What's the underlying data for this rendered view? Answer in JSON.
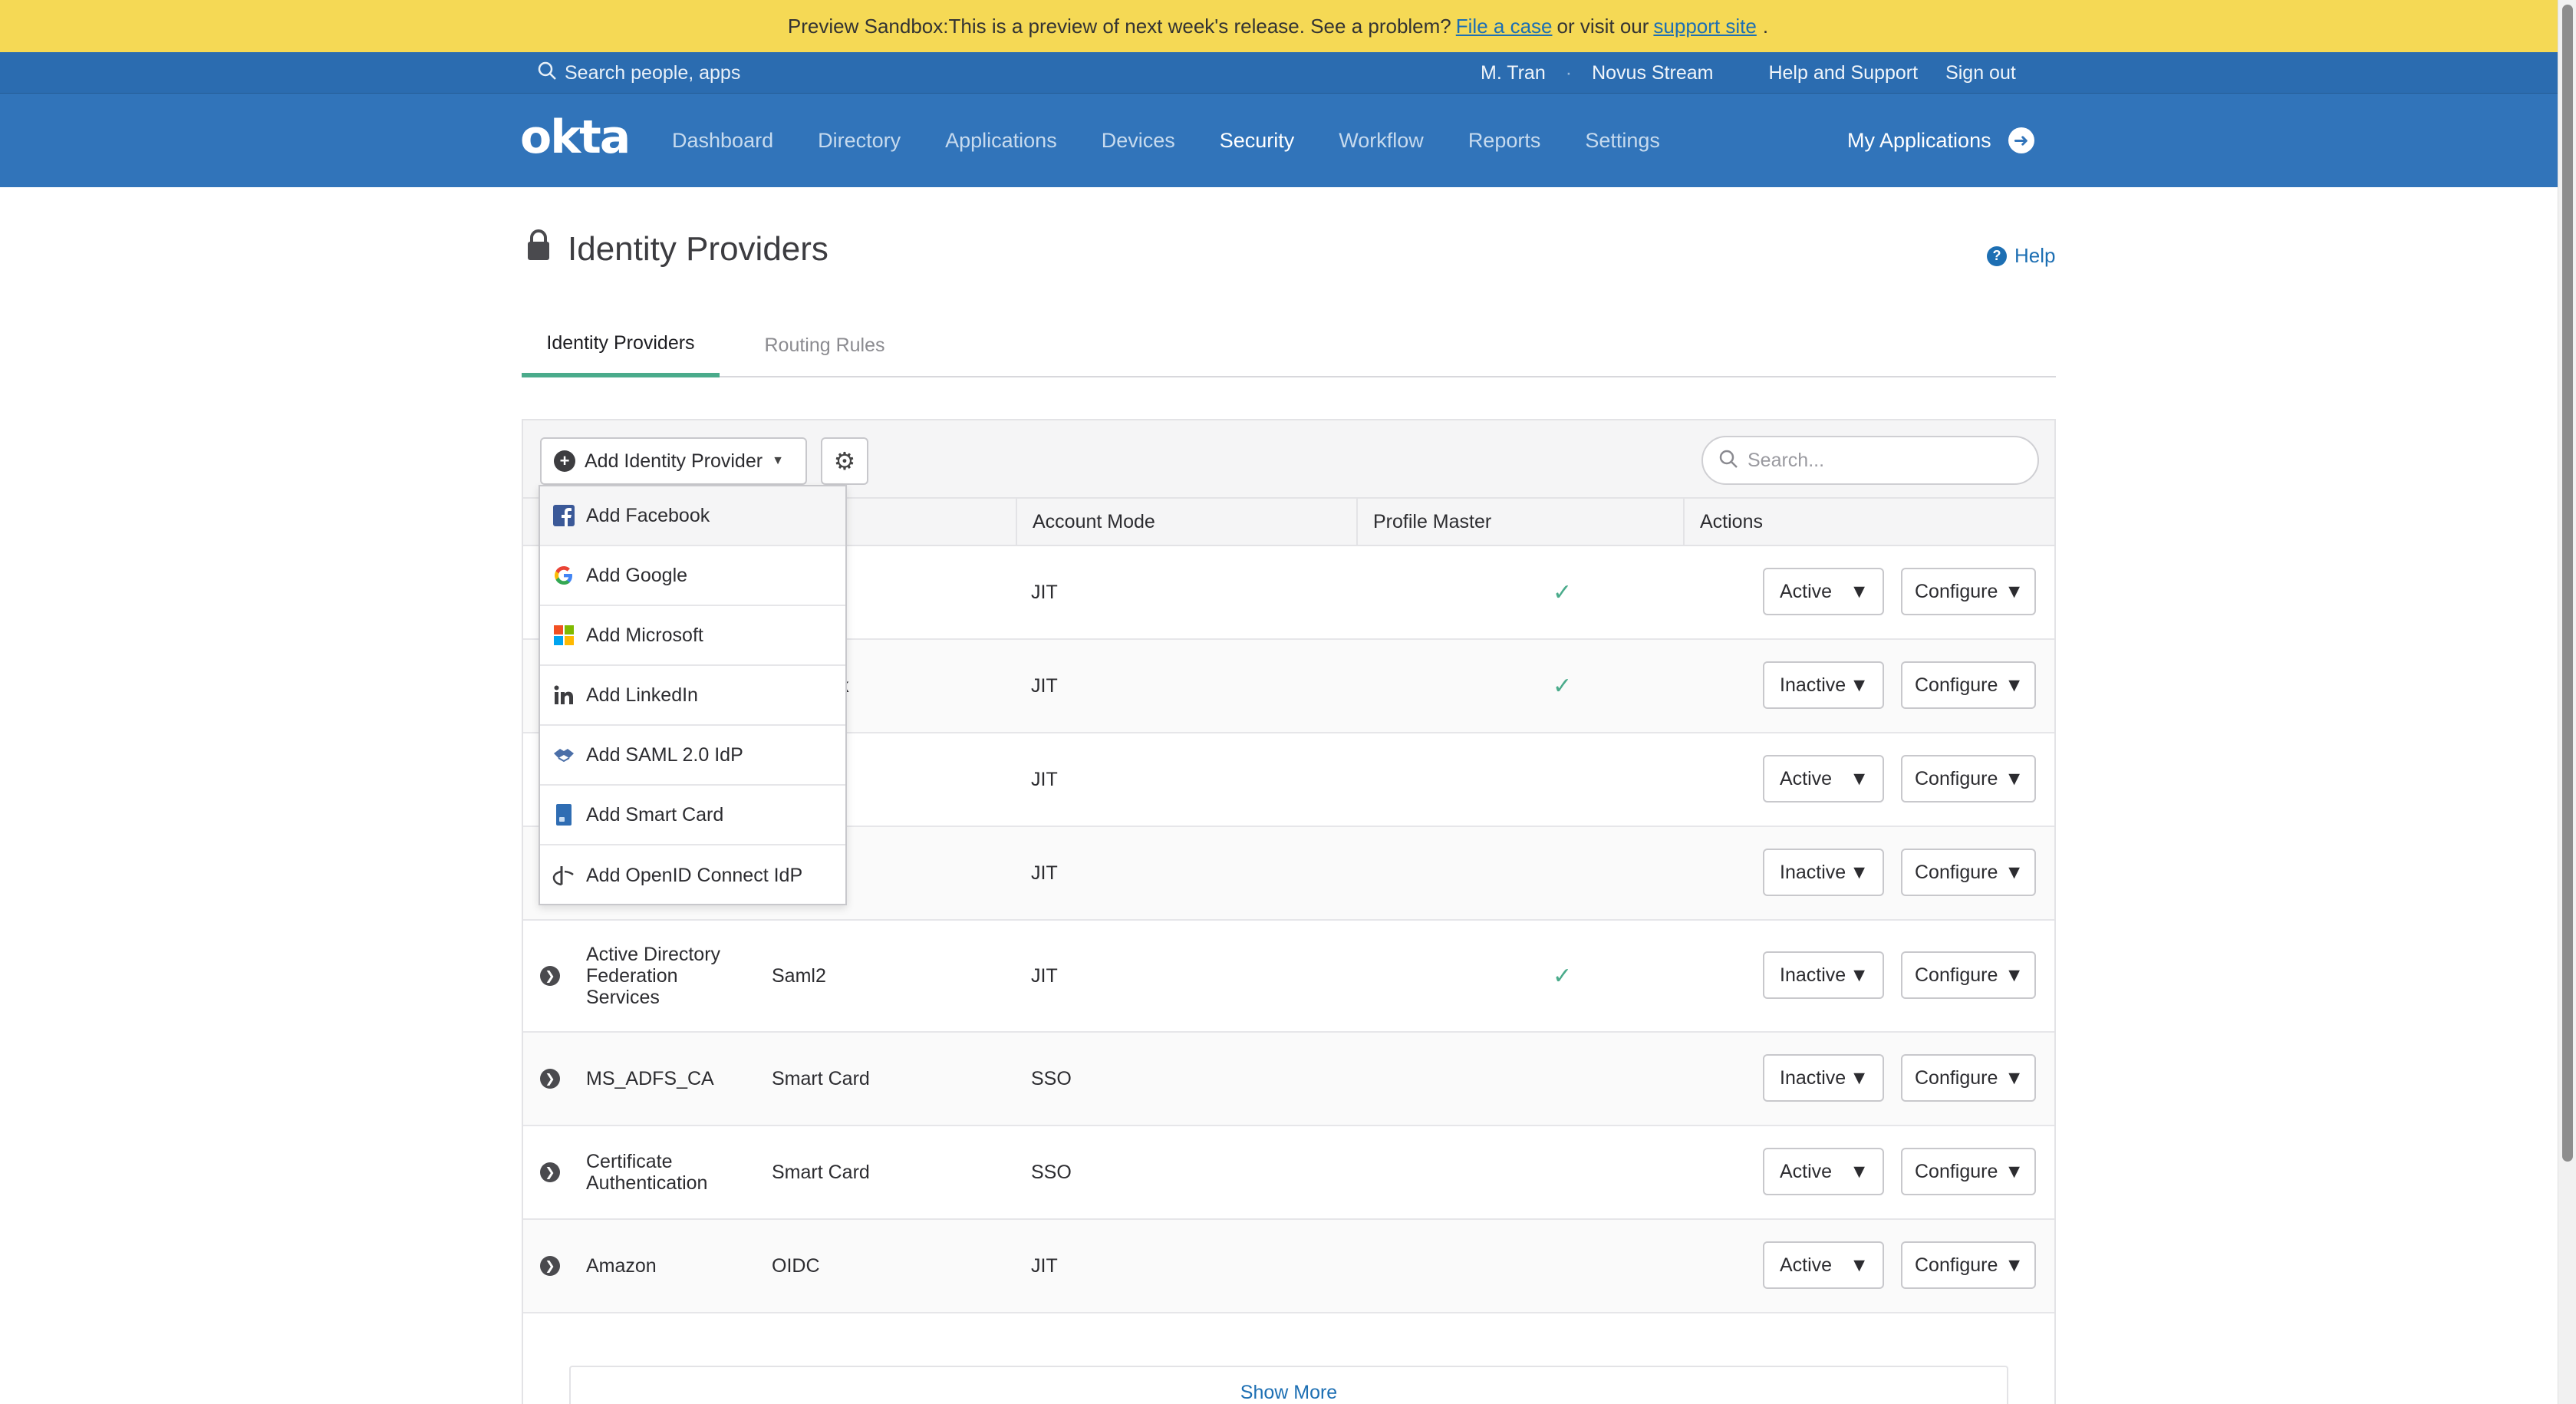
{
  "banner": {
    "text": "Preview Sandbox:This is a preview of next week's release. See a problem?",
    "link1": "File a case",
    "middle": "or visit our",
    "link2": "support site",
    "end": ".",
    "bg_color": "#f5d955"
  },
  "topbar": {
    "search_placeholder": "Search people, apps",
    "user": "M. Tran",
    "separator": "·",
    "org": "Novus Stream",
    "help_support": "Help and Support",
    "sign_out": "Sign out"
  },
  "nav": {
    "logo": "okta",
    "items": [
      "Dashboard",
      "Directory",
      "Applications",
      "Devices",
      "Security",
      "Workflow",
      "Reports",
      "Settings"
    ],
    "active": "Security",
    "my_apps": "My Applications",
    "bg_color": "#3174ba"
  },
  "page": {
    "title": "Identity Providers",
    "help": "Help",
    "tabs": [
      "Identity Providers",
      "Routing Rules"
    ],
    "active_tab": "Identity Providers"
  },
  "toolbar": {
    "add_label": "Add Identity Provider",
    "search_placeholder": "Search..."
  },
  "table": {
    "headers": [
      "Account Mode",
      "Profile Master",
      "Actions"
    ],
    "rows": [
      {
        "name": "",
        "type": "",
        "mode": "JIT",
        "master": true,
        "status": "Active",
        "configure": "Configure"
      },
      {
        "name": "",
        "type": "k",
        "mode": "JIT",
        "master": true,
        "status": "Inactive",
        "configure": "Configure"
      },
      {
        "name": "",
        "type": "",
        "mode": "JIT",
        "master": false,
        "status": "Active",
        "configure": "Configure"
      },
      {
        "name": "",
        "type": "",
        "mode": "JIT",
        "master": false,
        "status": "Inactive",
        "configure": "Configure"
      },
      {
        "name": "Active Directory Federation Services",
        "type": "Saml2",
        "mode": "JIT",
        "master": true,
        "status": "Inactive",
        "configure": "Configure"
      },
      {
        "name": "MS_ADFS_CA",
        "type": "Smart Card",
        "mode": "SSO",
        "master": false,
        "status": "Inactive",
        "configure": "Configure"
      },
      {
        "name": "Certificate Authentication",
        "type": "Smart Card",
        "mode": "SSO",
        "master": false,
        "status": "Active",
        "configure": "Configure"
      },
      {
        "name": "Amazon",
        "type": "OIDC",
        "mode": "JIT",
        "master": false,
        "status": "Active",
        "configure": "Configure"
      }
    ],
    "show_more": "Show More"
  },
  "menu": {
    "items": [
      {
        "label": "Add Facebook",
        "icon": "facebook-icon"
      },
      {
        "label": "Add Google",
        "icon": "google-icon"
      },
      {
        "label": "Add Microsoft",
        "icon": "microsoft-icon"
      },
      {
        "label": "Add LinkedIn",
        "icon": "linkedin-icon"
      },
      {
        "label": "Add SAML 2.0 IdP",
        "icon": "saml-icon"
      },
      {
        "label": "Add Smart Card",
        "icon": "smart-card-icon"
      },
      {
        "label": "Add OpenID Connect IdP",
        "icon": "openid-icon"
      }
    ]
  },
  "colors": {
    "accent": "#4aab8b",
    "link": "#1d6fb3"
  }
}
